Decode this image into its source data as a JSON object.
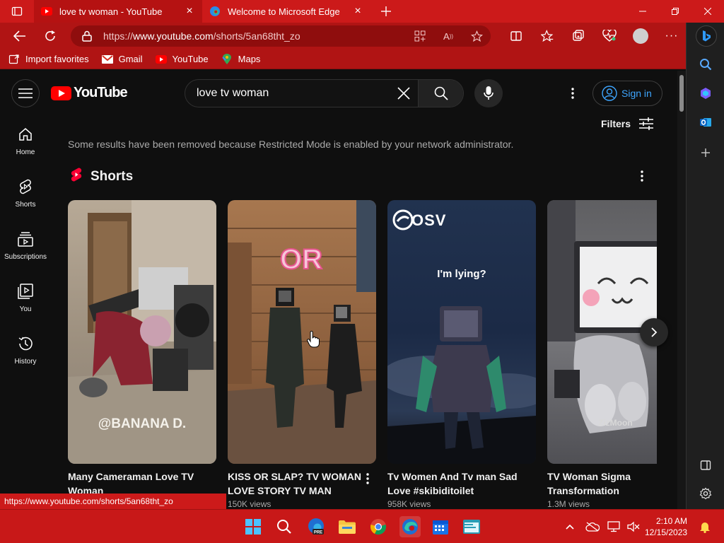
{
  "browser": {
    "tabs": [
      {
        "title": "love tv woman - YouTube",
        "active": true
      },
      {
        "title": "Welcome to Microsoft Edge",
        "active": false
      }
    ],
    "url_prefix": "https://",
    "url_domain": "www.youtube.com",
    "url_path": "/shorts/5an68tht_zo",
    "favorites": [
      {
        "label": "Import favorites",
        "icon": "import-icon"
      },
      {
        "label": "Gmail",
        "icon": "gmail-icon"
      },
      {
        "label": "YouTube",
        "icon": "youtube-icon"
      },
      {
        "label": "Maps",
        "icon": "maps-icon"
      }
    ],
    "status_link": "https://www.youtube.com/shorts/5an68tht_zo",
    "accent": "#cc1a1a"
  },
  "youtube": {
    "logo_text": "YouTube",
    "search_query": "love tv woman",
    "sign_in": "Sign in",
    "guide": [
      {
        "label": "Home",
        "icon": "home-icon"
      },
      {
        "label": "Shorts",
        "icon": "shorts-icon"
      },
      {
        "label": "Subscriptions",
        "icon": "subscriptions-icon"
      },
      {
        "label": "You",
        "icon": "you-icon"
      },
      {
        "label": "History",
        "icon": "history-icon"
      }
    ],
    "filters_label": "Filters",
    "restricted_notice": "Some results have been removed because Restricted Mode is enabled by your network administrator.",
    "shorts_title": "Shorts",
    "shorts": [
      {
        "title": "Many Cameraman Love TV Woman",
        "views": "",
        "thumb_text": "@BANANA D."
      },
      {
        "title": "KISS OR SLAP? TV WOMAN LOVE STORY TV MAN",
        "views": "150K views",
        "thumb_text": "OR"
      },
      {
        "title": "Tv Women And Tv man Sad Love #skibiditoilet",
        "views": "958K views",
        "thumb_text": "I'm lying?",
        "thumb_brand": "OSV"
      },
      {
        "title": "TV Woman Sigma Transformation",
        "views": "1.3M views",
        "thumb_text": "ZizMoon"
      }
    ]
  },
  "taskbar": {
    "time": "2:10 AM",
    "date": "12/15/2023"
  }
}
